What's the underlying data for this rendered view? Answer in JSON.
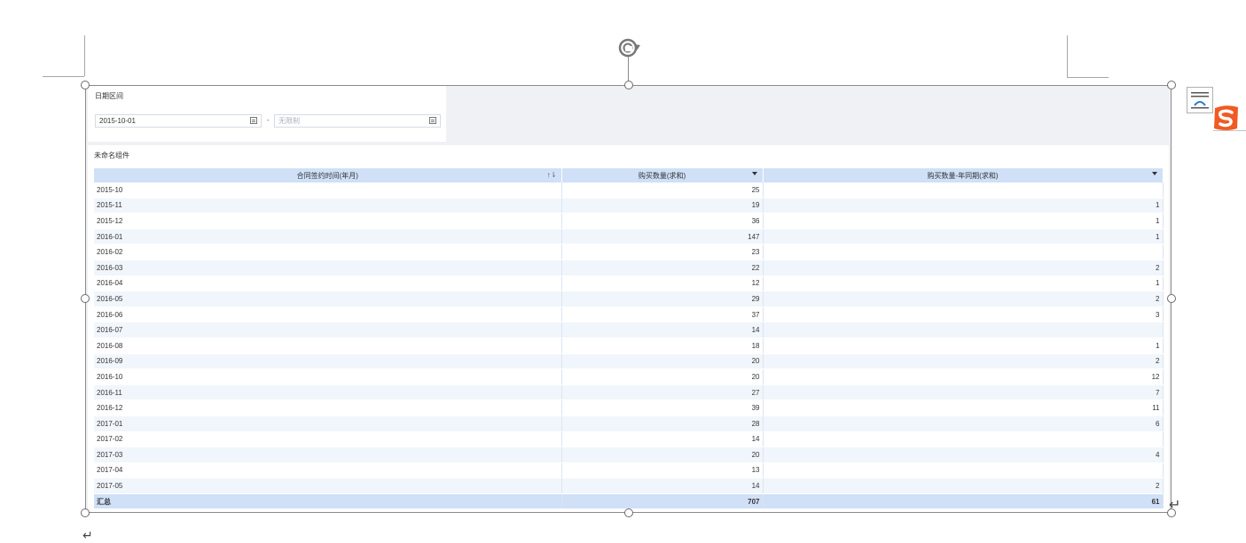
{
  "filter": {
    "title": "日期区间",
    "start_value": "2015-10-01",
    "separator": "-",
    "end_placeholder": "无限制"
  },
  "widget": {
    "title": "未命名组件"
  },
  "table": {
    "headers": [
      "合同签约时间(年月)",
      "购买数量(求和)",
      "购买数量-年同期(求和)"
    ],
    "rows": [
      [
        "2015-10",
        "25",
        ""
      ],
      [
        "2015-11",
        "19",
        "1"
      ],
      [
        "2015-12",
        "36",
        "1"
      ],
      [
        "2016-01",
        "147",
        "1"
      ],
      [
        "2016-02",
        "23",
        ""
      ],
      [
        "2016-03",
        "22",
        "2"
      ],
      [
        "2016-04",
        "12",
        "1"
      ],
      [
        "2016-05",
        "29",
        "2"
      ],
      [
        "2016-06",
        "37",
        "3"
      ],
      [
        "2016-07",
        "14",
        ""
      ],
      [
        "2016-08",
        "18",
        "1"
      ],
      [
        "2016-09",
        "20",
        "2"
      ],
      [
        "2016-10",
        "20",
        "12"
      ],
      [
        "2016-11",
        "27",
        "7"
      ],
      [
        "2016-12",
        "39",
        "11"
      ],
      [
        "2017-01",
        "28",
        "6"
      ],
      [
        "2017-02",
        "14",
        ""
      ],
      [
        "2017-03",
        "20",
        "4"
      ],
      [
        "2017-04",
        "13",
        ""
      ],
      [
        "2017-05",
        "14",
        "2"
      ]
    ],
    "total": [
      "汇总",
      "707",
      "61"
    ]
  },
  "icons": {
    "rotate": "rotate-handle-icon",
    "layout": "layout-options-icon",
    "sogou": "sogou-ime-icon",
    "calendar": "calendar-icon",
    "sort": "sort-icon",
    "dropdown": "dropdown-caret-icon",
    "paragraph": "paragraph-mark-icon"
  },
  "colors": {
    "header_bg": "#cfe0f7",
    "row_alt_bg": "#f1f6fc",
    "dashboard_bg": "#f0f1f4",
    "sogou": "#f15a22"
  }
}
